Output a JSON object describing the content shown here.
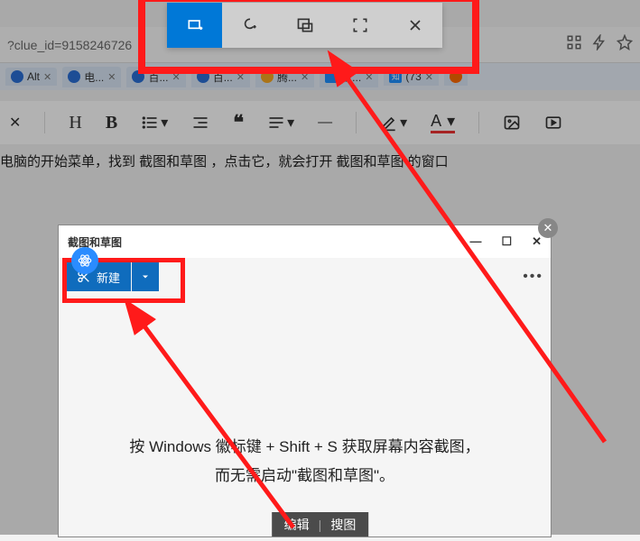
{
  "url_bar": {
    "text": "?clue_id=9158246726"
  },
  "tabs": [
    {
      "label": "Alt",
      "favColor": "#2a6fd6"
    },
    {
      "label": "电...",
      "favColor": "#2a6fd6"
    },
    {
      "label": "百...",
      "favColor": "#2a6fd6"
    },
    {
      "label": "百...",
      "favColor": "#2a6fd6"
    },
    {
      "label": "腾...",
      "favColor": "#f5a623"
    },
    {
      "label": "百...",
      "favColor": "#1e90ff"
    },
    {
      "label": "(73",
      "favColor": "#1e90ff",
      "badge": "知"
    },
    {
      "label": "",
      "favColor": "#ff6a00"
    }
  ],
  "body_text": "电脑的开始菜单，找到 截图和草图 ，点击它，就会打开 截图和草图 的窗口",
  "inner": {
    "title": "截图和草图",
    "new_label": "新建",
    "message_line1": "按 Windows 徽标键 + Shift + S 获取屏幕内容截图，",
    "message_line2": "而无需启动\"截图和草图\"。"
  },
  "image_actions": {
    "edit": "编辑",
    "search": "搜图"
  }
}
